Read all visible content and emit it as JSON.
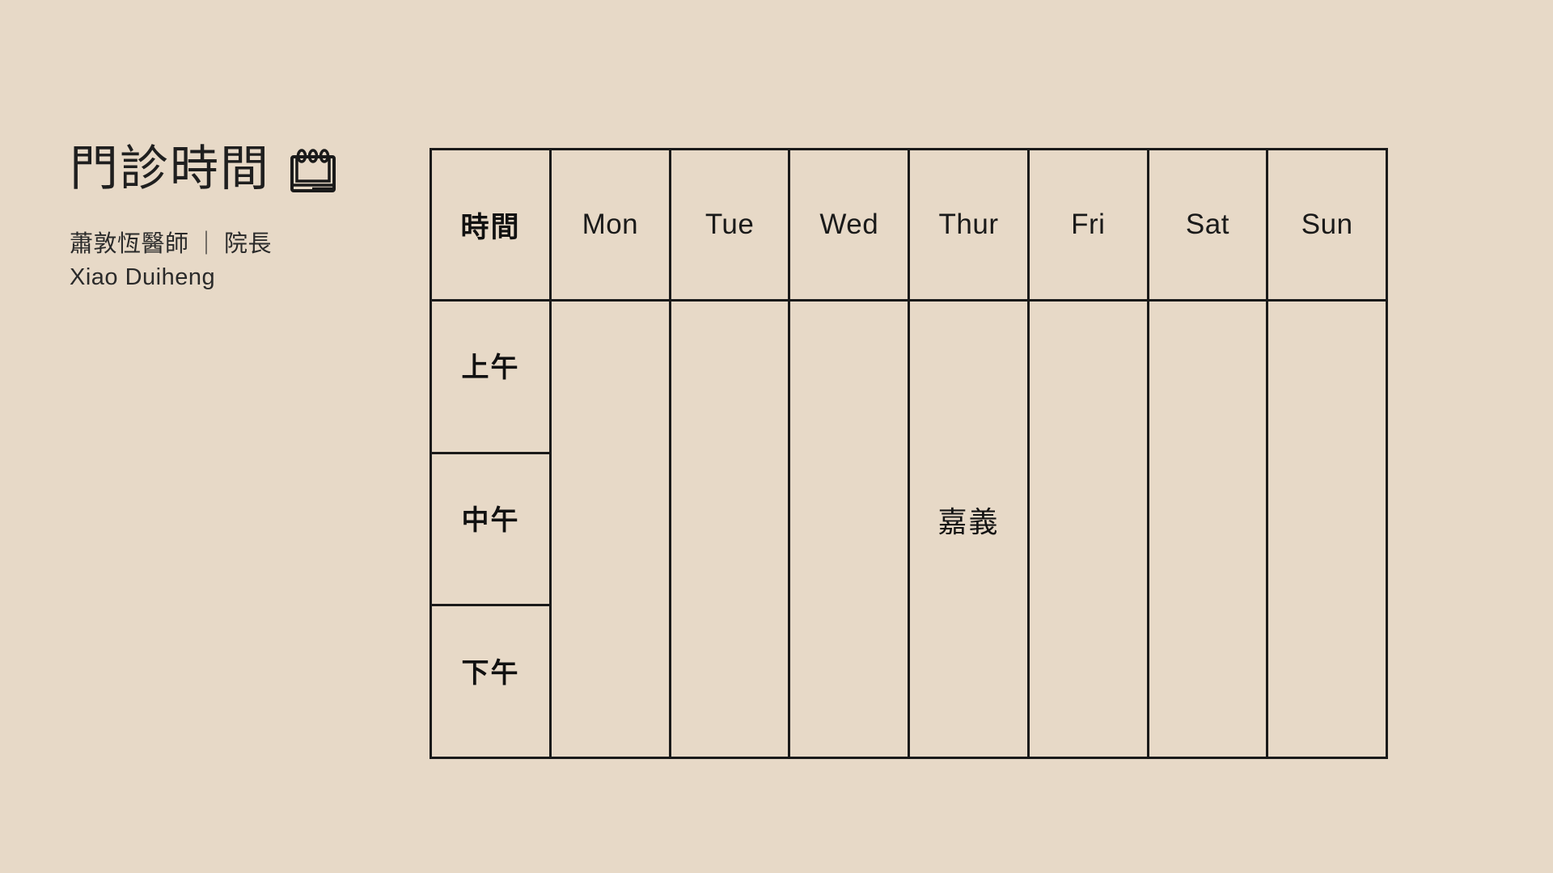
{
  "page": {
    "background_color": "#e7d9c7",
    "text_color": "#1c1c1c",
    "border_color": "#1a1a1a"
  },
  "header": {
    "title": "門診時間",
    "icon": "notepad-calendar-icon",
    "doctor_name": "蕭敦恆醫師",
    "separator": "｜",
    "doctor_role": "院長",
    "doctor_name_romanized": "Xiao Duiheng"
  },
  "schedule": {
    "time_column_header": "時間",
    "day_headers": [
      "Mon",
      "Tue",
      "Wed",
      "Thur",
      "Fri",
      "Sat",
      "Sun"
    ],
    "row_labels": [
      "上午",
      "中午",
      "下午"
    ],
    "cells": [
      {
        "row": "上午",
        "values": [
          "",
          "",
          "",
          "",
          "",
          "",
          ""
        ]
      },
      {
        "row": "中午",
        "values": [
          "",
          "",
          "",
          "嘉義",
          "",
          "",
          ""
        ]
      },
      {
        "row": "下午",
        "values": [
          "",
          "",
          "",
          "",
          "",
          "",
          ""
        ]
      }
    ]
  }
}
